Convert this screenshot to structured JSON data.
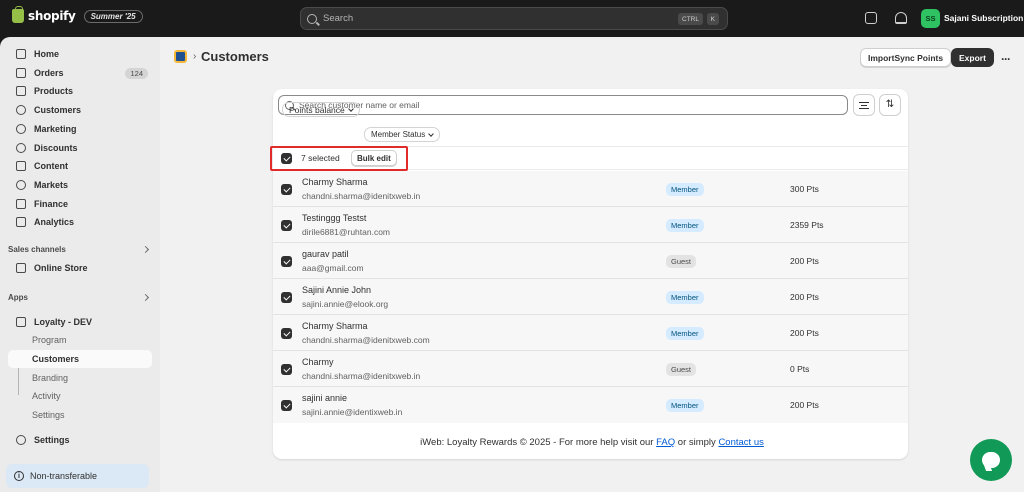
{
  "topbar": {
    "brand": "shopify",
    "edition_badge": "Summer '25",
    "search_placeholder": "Search",
    "shortcut_ctrl": "CTRL",
    "shortcut_k": "K",
    "avatar_initials": "SS",
    "store_name": "Sajani Subscription",
    "accent_color": "#2ec262"
  },
  "sidebar": {
    "items": [
      {
        "label": "Home",
        "icon": "home-icon"
      },
      {
        "label": "Orders",
        "icon": "orders-icon",
        "count": "124"
      },
      {
        "label": "Products",
        "icon": "products-icon"
      },
      {
        "label": "Customers",
        "icon": "customers-icon"
      },
      {
        "label": "Marketing",
        "icon": "marketing-icon"
      },
      {
        "label": "Discounts",
        "icon": "discounts-icon"
      },
      {
        "label": "Content",
        "icon": "content-icon"
      },
      {
        "label": "Markets",
        "icon": "markets-icon"
      },
      {
        "label": "Finance",
        "icon": "finance-icon"
      },
      {
        "label": "Analytics",
        "icon": "analytics-icon"
      }
    ],
    "sales_channels_label": "Sales channels",
    "online_store_label": "Online Store",
    "apps_label": "Apps",
    "app_name": "Loyalty - DEV",
    "app_subitems": [
      "Program",
      "Customers",
      "Branding",
      "Activity",
      "Settings"
    ],
    "active_subitem": "Customers",
    "settings_label": "Settings",
    "notice_label": "Non-transferable"
  },
  "main": {
    "page_title": "Customers",
    "import_button": "ImportSync Points",
    "export_button": "Export",
    "search_placeholder": "Search customer name or email",
    "filters": [
      "Points balance",
      "Member Status"
    ],
    "selected_text": "7 selected",
    "bulk_edit_button": "Bulk edit",
    "customers": [
      {
        "name": "Charmy Sharma",
        "email": "chandni.sharma@idenitxweb.in",
        "tier": "Member",
        "points": "300 Pts"
      },
      {
        "name": "Testinggg Testst",
        "email": "dirile6881@ruhtan.com",
        "tier": "Member",
        "points": "2359 Pts"
      },
      {
        "name": "gaurav patil",
        "email": "aaa@gmail.com",
        "tier": "Guest",
        "points": "200 Pts"
      },
      {
        "name": "Sajini Annie John",
        "email": "sajini.annie@elook.org",
        "tier": "Member",
        "points": "200 Pts"
      },
      {
        "name": "Charmy Sharma",
        "email": "chandni.sharma@idenitxweb.com",
        "tier": "Member",
        "points": "200 Pts"
      },
      {
        "name": "Charmy",
        "email": "chandni.sharma@idenitxweb.in",
        "tier": "Guest",
        "points": "0 Pts"
      },
      {
        "name": "sajini annie",
        "email": "sajini.annie@identixweb.in",
        "tier": "Member",
        "points": "200 Pts"
      }
    ],
    "footer": {
      "text_before": "iWeb: Loyalty Rewards © 2025 - For more help visit our",
      "faq_link": "FAQ",
      "text_middle": "or simply",
      "contact_link": "Contact us"
    },
    "highlight_color": "#e12b2b",
    "chat_color": "#119a57"
  }
}
